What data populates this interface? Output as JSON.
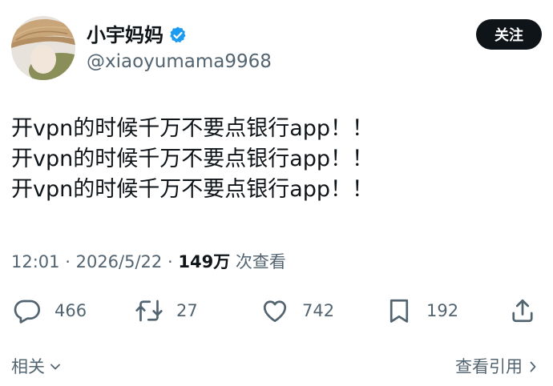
{
  "author": {
    "display_name": "小宇妈妈",
    "handle": "@xiaoyumama9968",
    "verified": true
  },
  "follow_button": {
    "label": "关注"
  },
  "post": {
    "lines": [
      "开vpn的时候千万不要点银行app！！",
      "开vpn的时候千万不要点银行app！！",
      "开vpn的时候千万不要点银行app！！"
    ]
  },
  "meta": {
    "time": "12:01",
    "separator": "·",
    "date": "2026/5/22",
    "separator2": "·",
    "views_count": "149万",
    "views_label": "次查看"
  },
  "actions": {
    "replies": "466",
    "reposts": "27",
    "likes": "742",
    "bookmarks": "192"
  },
  "footer": {
    "related_label": "相关",
    "quotes_label": "查看引用"
  },
  "colors": {
    "text": "#0f1419",
    "secondary": "#536471",
    "verified_blue": "#1d9bf0",
    "button_bg": "#0f1419"
  }
}
